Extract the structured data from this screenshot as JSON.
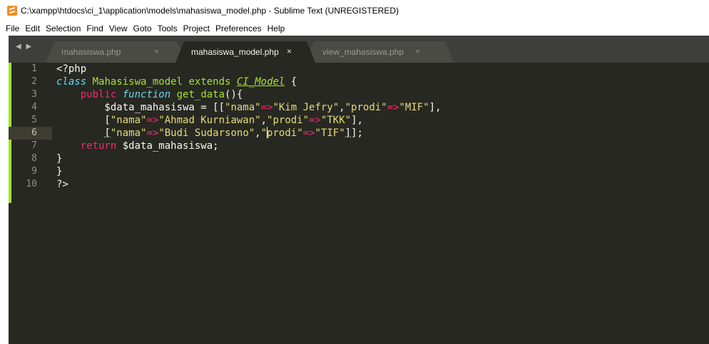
{
  "window": {
    "title": "C:\\xampp\\htdocs\\ci_1\\application\\models\\mahasiswa_model.php - Sublime Text (UNREGISTERED)"
  },
  "menu": [
    "File",
    "Edit",
    "Selection",
    "Find",
    "View",
    "Goto",
    "Tools",
    "Project",
    "Preferences",
    "Help"
  ],
  "tabs": [
    {
      "label": "mahasiswa.php",
      "close": "×",
      "active": false
    },
    {
      "label": "mahasiswa_model.php",
      "close": "×",
      "active": true
    },
    {
      "label": "view_mahasiswa.php",
      "close": "×",
      "active": false
    }
  ],
  "nav_arrows": "◀ ▶",
  "editor": {
    "current_line": 6,
    "lines": [
      {
        "n": "1",
        "tokens": [
          {
            "t": "<?php",
            "k": "pl"
          }
        ]
      },
      {
        "n": "2",
        "tokens": [
          {
            "t": "class",
            "k": "st"
          },
          {
            "t": " ",
            "k": "pl"
          },
          {
            "t": "Mahasiswa_model",
            "k": "cls"
          },
          {
            "t": " ",
            "k": "pl"
          },
          {
            "t": "extends",
            "k": "cls"
          },
          {
            "t": " ",
            "k": "pl"
          },
          {
            "t": "CI_Model",
            "k": "inh"
          },
          {
            "t": " {",
            "k": "pl"
          }
        ]
      },
      {
        "n": "3",
        "tokens": [
          {
            "t": "    public",
            "k": "kw"
          },
          {
            "t": " ",
            "k": "pl"
          },
          {
            "t": "function",
            "k": "st"
          },
          {
            "t": " ",
            "k": "pl"
          },
          {
            "t": "get_data",
            "k": "cls"
          },
          {
            "t": "(){",
            "k": "pl"
          }
        ]
      },
      {
        "n": "4",
        "tokens": [
          {
            "t": "        $data_mahasiswa = [[",
            "k": "pl"
          },
          {
            "t": "\"nama\"",
            "k": "str"
          },
          {
            "t": "=>",
            "k": "kw"
          },
          {
            "t": "\"Kim Jefry\"",
            "k": "str"
          },
          {
            "t": ",",
            "k": "pl"
          },
          {
            "t": "\"prodi\"",
            "k": "str"
          },
          {
            "t": "=>",
            "k": "kw"
          },
          {
            "t": "\"MIF\"",
            "k": "str"
          },
          {
            "t": "],",
            "k": "pl"
          }
        ]
      },
      {
        "n": "5",
        "tokens": [
          {
            "t": "        [",
            "k": "pl"
          },
          {
            "t": "\"nama\"",
            "k": "str"
          },
          {
            "t": "=>",
            "k": "kw"
          },
          {
            "t": "\"Ahmad Kurniawan\"",
            "k": "str"
          },
          {
            "t": ",",
            "k": "pl"
          },
          {
            "t": "\"prodi\"",
            "k": "str"
          },
          {
            "t": "=>",
            "k": "kw"
          },
          {
            "t": "\"TKK\"",
            "k": "str"
          },
          {
            "t": "],",
            "k": "pl"
          }
        ]
      },
      {
        "n": "6",
        "tokens": [
          {
            "t": "        ",
            "k": "pl"
          },
          {
            "t": "[",
            "k": "pl und"
          },
          {
            "t": "\"nama\"",
            "k": "str"
          },
          {
            "t": "=>",
            "k": "kw"
          },
          {
            "t": "\"Budi Sudarsono\"",
            "k": "str"
          },
          {
            "t": ",",
            "k": "pl"
          },
          {
            "t": "\"",
            "k": "str"
          },
          {
            "t": "CARET",
            "k": "caret"
          },
          {
            "t": "prodi\"",
            "k": "str"
          },
          {
            "t": "=>",
            "k": "kw"
          },
          {
            "t": "\"TIF\"",
            "k": "str"
          },
          {
            "t": "]",
            "k": "pl und"
          },
          {
            "t": "];",
            "k": "pl"
          }
        ]
      },
      {
        "n": "7",
        "tokens": [
          {
            "t": "    return",
            "k": "kw"
          },
          {
            "t": " $data_mahasiswa;",
            "k": "pl"
          }
        ]
      },
      {
        "n": "8",
        "tokens": [
          {
            "t": "}",
            "k": "pl"
          }
        ]
      },
      {
        "n": "9",
        "tokens": [
          {
            "t": "}",
            "k": "pl"
          }
        ]
      },
      {
        "n": "10",
        "tokens": [
          {
            "t": "?>",
            "k": "pl"
          }
        ]
      }
    ]
  },
  "colors": {
    "editor_bg": "#272822",
    "tabbar_bg": "#3e3f3a",
    "keyword": "#f92672",
    "storage": "#66d9ef",
    "entity": "#a6e22e",
    "string": "#e6db74",
    "text": "#f8f8f2"
  },
  "icons": {
    "app": "sublime-text-icon",
    "tab_close": "close-icon",
    "nav": "tab-nav-arrows-icon"
  }
}
